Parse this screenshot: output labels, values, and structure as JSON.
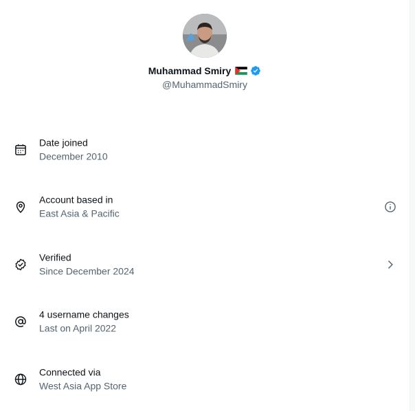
{
  "profile": {
    "name": "Muhammad Smiry",
    "flag_icon": "palestine-flag-icon",
    "verified_icon": "verified-badge-icon",
    "handle": "@MuhammadSmiry",
    "verified_color": "#1d9bf0"
  },
  "rows": [
    {
      "icon": "calendar-icon",
      "title": "Date joined",
      "subtitle": "December 2010",
      "action_icon": ""
    },
    {
      "icon": "location-pin-icon",
      "title": "Account based in",
      "subtitle": "East Asia & Pacific",
      "action_icon": "info-icon"
    },
    {
      "icon": "verified-check-icon",
      "title": "Verified",
      "subtitle": "Since December 2024",
      "action_icon": "chevron-right-icon"
    },
    {
      "icon": "at-sign-icon",
      "title": "4 username changes",
      "subtitle": "Last on April 2022",
      "action_icon": ""
    },
    {
      "icon": "globe-icon",
      "title": "Connected via",
      "subtitle": "West Asia App Store",
      "action_icon": ""
    }
  ],
  "colors": {
    "primary_text": "#0f1419",
    "secondary_text": "#536471",
    "background": "#ffffff"
  }
}
